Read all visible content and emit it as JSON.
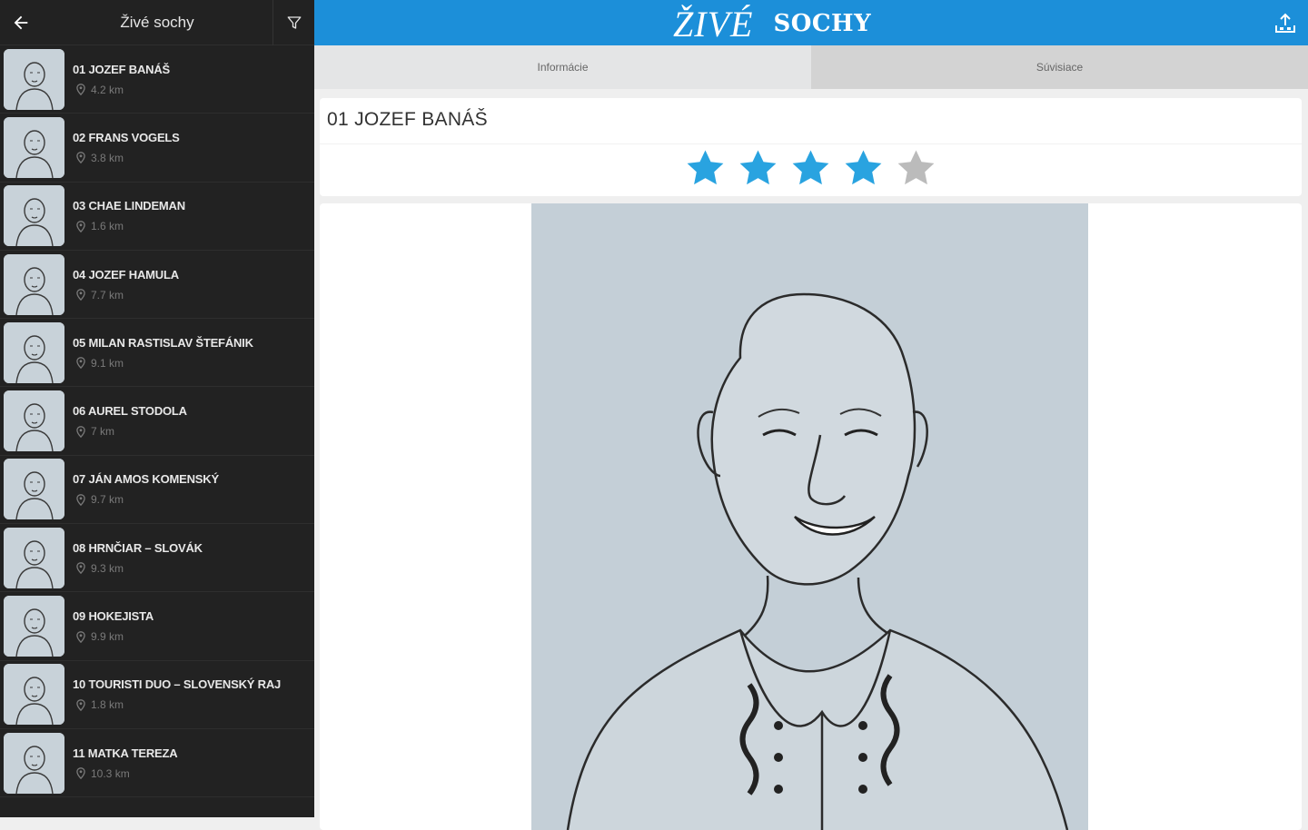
{
  "app": {
    "sidebar_title": "Živé sochy",
    "logo_primary": "ŽIVÉ",
    "logo_secondary": "SOCHY"
  },
  "icons": {
    "back": "arrow-left-icon",
    "filter": "filter-icon",
    "share": "share-icon",
    "location": "location-pin-icon",
    "star": "star-icon"
  },
  "colors": {
    "accent": "#1c8fd9",
    "star_active": "#29a3e0",
    "star_inactive": "#bbbbbb",
    "sidebar_bg": "#222222"
  },
  "tabs": [
    {
      "label": "Informácie",
      "active": true
    },
    {
      "label": "Súvisiace",
      "active": false
    }
  ],
  "statues": [
    {
      "name": "01 JOZEF BANÁŠ",
      "distance": "4.2 km"
    },
    {
      "name": "02 FRANS VOGELS",
      "distance": "3.8 km"
    },
    {
      "name": "03 CHAE LINDEMAN",
      "distance": "1.6 km"
    },
    {
      "name": "04 JOZEF HAMULA",
      "distance": "7.7 km"
    },
    {
      "name": "05 MILAN RASTISLAV ŠTEFÁNIK",
      "distance": "9.1 km"
    },
    {
      "name": "06 AUREL STODOLA",
      "distance": "7 km"
    },
    {
      "name": "07 JÁN AMOS KOMENSKÝ",
      "distance": "9.7 km"
    },
    {
      "name": "08 HRNČIAR – SLOVÁK",
      "distance": "9.3 km"
    },
    {
      "name": "09 HOKEJISTA",
      "distance": "9.9 km"
    },
    {
      "name": "10 TOURISTI DUO – SLOVENSKÝ RAJ",
      "distance": "1.8 km"
    },
    {
      "name": "11 MATKA TEREZA",
      "distance": "10.3 km"
    }
  ],
  "detail": {
    "title": "01 JOZEF BANÁŠ",
    "rating": 4,
    "rating_max": 5
  }
}
